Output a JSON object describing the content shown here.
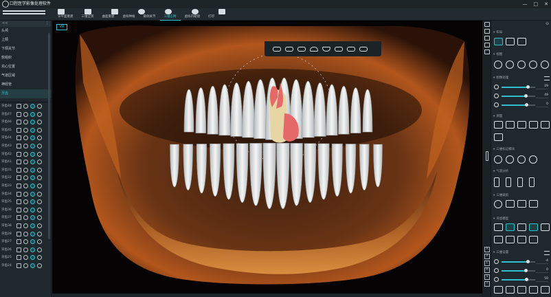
{
  "app": {
    "title": "口腔医学影像处理软件",
    "window_controls": [
      "—",
      "□",
      "✕"
    ]
  },
  "toolbar": {
    "icons": [
      "save-icon",
      "edit-icon",
      "layout-icon",
      "settings-icon",
      "help-icon",
      "info-icon",
      "exit-icon"
    ],
    "tabs": [
      "牙平面重建",
      "三维全景",
      "曲面重建",
      "虚拟种植",
      "颞颌关节",
      "三维正畸",
      "虚拟内窥镜",
      "打印"
    ],
    "active_tab_index": 5
  },
  "left_panel": {
    "collapse_label": "<<",
    "options_label": "⋮",
    "items": [
      "头颅",
      "上颌",
      "下颌关节",
      "软组织",
      "充心位置",
      "气道区域",
      "神经管",
      "牙齿"
    ],
    "selected_item_index": 7,
    "teeth": [
      "牙齿48",
      "牙齿47",
      "牙齿46",
      "牙齿45",
      "牙齿44",
      "牙齿43",
      "牙齿42",
      "牙齿41",
      "牙齿31",
      "牙齿32",
      "牙齿33",
      "牙齿34",
      "牙齿35",
      "牙齿36",
      "牙齿37",
      "牙齿38",
      "牙齿28",
      "牙齿27",
      "牙齿26",
      "牙齿25",
      "牙齿24"
    ]
  },
  "viewport": {
    "view_badge": "VR",
    "toolbar_icons": [
      "skull-lateral-icon",
      "skull-front-icon",
      "skull-top-icon",
      "arch-upper-icon",
      "arch-lower-icon",
      "tooth-crown-icon",
      "tooth-root-icon",
      "tooth-section-icon"
    ]
  },
  "right_panel": {
    "sections": {
      "layout": "布局",
      "view": "视图",
      "image_processing": "图像处理",
      "measure": "测量",
      "annotation": "三维标记模块",
      "airway": "气道分析",
      "clipping": "三维裁剪",
      "tooth_model": "牙齿模型",
      "volume_settings": "三维设置"
    },
    "image_sliders": [
      {
        "icon": "brightness-icon",
        "value": "29",
        "fraction": 0.78
      },
      {
        "icon": "contrast-icon",
        "value": "49",
        "fraction": 0.72
      },
      {
        "icon": "sharpen-icon",
        "value": "0",
        "fraction": 0.75
      }
    ],
    "volume_sliders": [
      {
        "icon": "brightness-icon",
        "value": "-4",
        "fraction": 0.78
      },
      {
        "icon": "contrast-icon",
        "value": "0",
        "fraction": 0.72
      },
      {
        "icon": "opacity-icon",
        "value": "50",
        "fraction": 0.75
      }
    ],
    "strip_letters": [
      "A",
      "P",
      "L",
      "R",
      "S",
      "I"
    ]
  },
  "colors": {
    "accent": "#2fc0cf",
    "panel_bg": "#1f282c",
    "viewport_bg": "#050303",
    "selected_tooth_red": "#e46a6a",
    "selected_tooth_cream": "#e7d6a4"
  }
}
